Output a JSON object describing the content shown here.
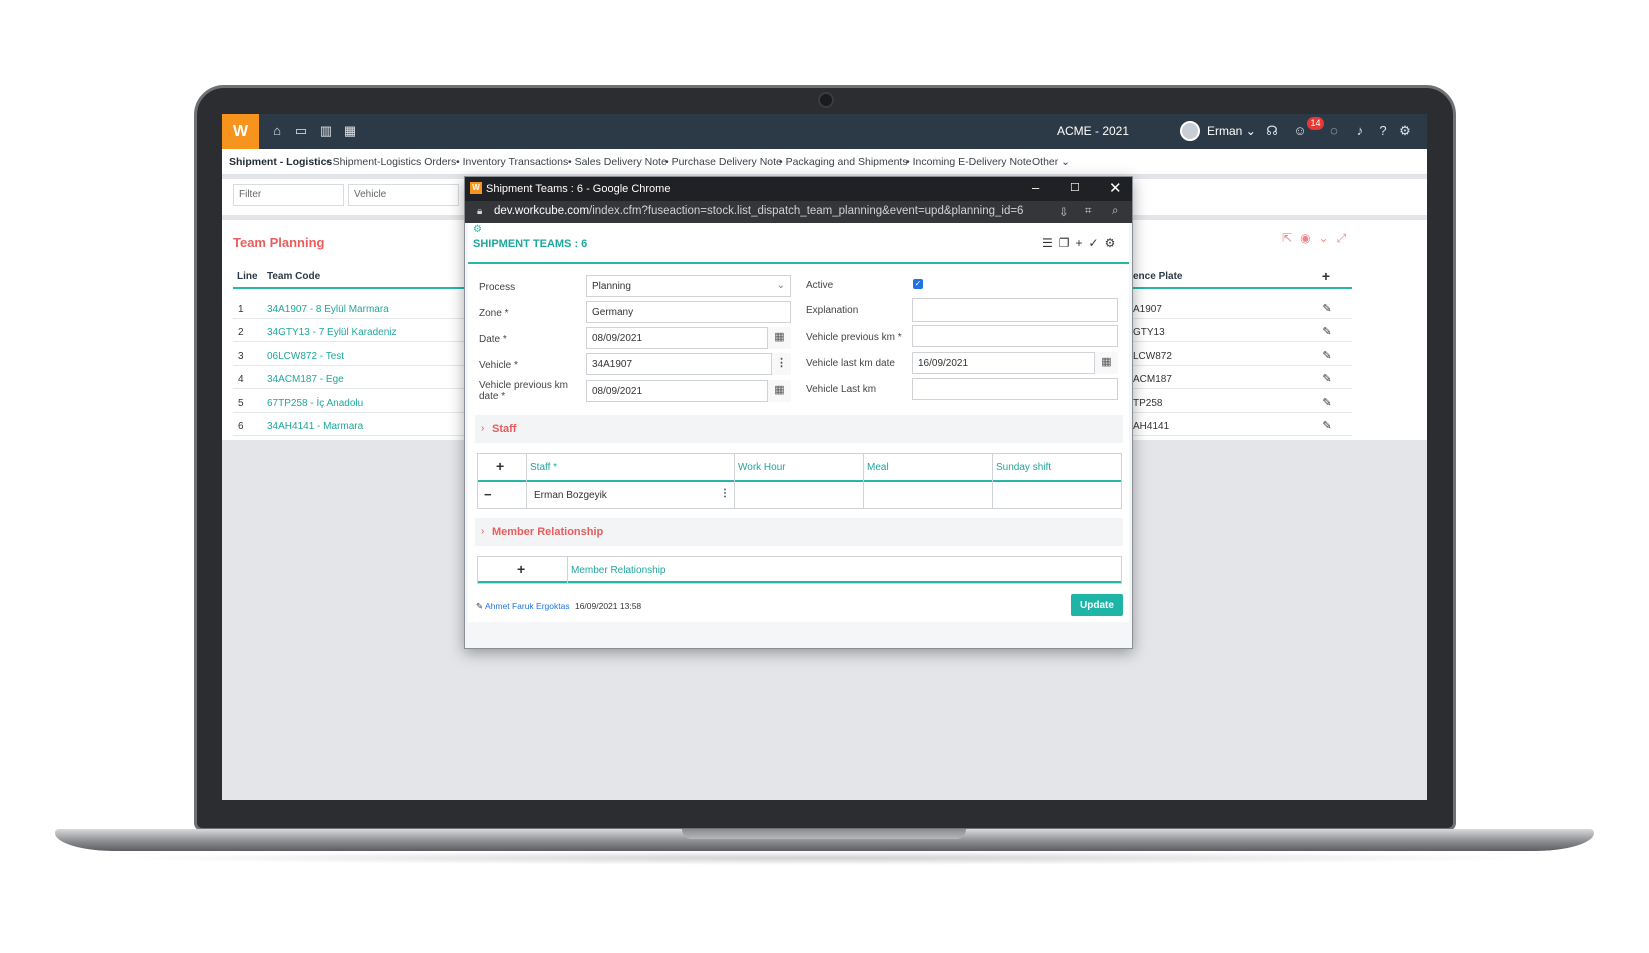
{
  "app": {
    "logo_text": "W",
    "company": "ACME - 2021",
    "user": "Erman",
    "notification_count": "14",
    "topbar_icons": [
      "home-icon",
      "box-icon",
      "chart-icon",
      "calendar-icon"
    ],
    "right_icons": [
      "headset-icon",
      "smile-icon",
      "chat-icon",
      "bell-icon",
      "help-icon",
      "gear-icon"
    ]
  },
  "subnav": {
    "items": [
      "Shipment - Logistics",
      "Shipment-Logistics Orders",
      "Inventory Transactions",
      "Sales Delivery Note",
      "Purchase Delivery Note",
      "Packaging and Shipments",
      "Incoming E-Delivery Note"
    ],
    "other": "Other"
  },
  "filters": {
    "filter_placeholder": "Filter",
    "vehicle_placeholder": "Vehicle"
  },
  "team_planning": {
    "title": "Team Planning",
    "columns": {
      "line": "Line",
      "team_code": "Team Code",
      "plate": "ence Plate"
    },
    "rows": [
      {
        "line": "1",
        "team": "34A1907 - 8 Eylül Marmara",
        "plate": "A1907"
      },
      {
        "line": "2",
        "team": "34GTY13 - 7 Eylül Karadeniz",
        "plate": "GTY13"
      },
      {
        "line": "3",
        "team": "06LCW872 - Test",
        "plate": "LCW872"
      },
      {
        "line": "4",
        "team": "34ACM187 - Ege",
        "plate": "ACM187"
      },
      {
        "line": "5",
        "team": "67TP258 - İç Anadolu",
        "plate": "TP258"
      },
      {
        "line": "6",
        "team": "34AH4141 - Marmara",
        "plate": "AH4141"
      }
    ]
  },
  "popup": {
    "window_title": "Shipment Teams : 6 - Google Chrome",
    "url_domain": "dev.workcube.com",
    "url_path": "/index.cfm?fuseaction=stock.list_dispatch_team_planning&event=upd&planning_id=6",
    "heading": "SHIPMENT TEAMS : 6",
    "labels": {
      "process": "Process",
      "zone": "Zone *",
      "date": "Date *",
      "vehicle": "Vehicle *",
      "vehicle_prev_km_date": "Vehicle previous km date *",
      "active": "Active",
      "explanation": "Explanation",
      "vehicle_prev_km": "Vehicle previous km *",
      "vehicle_last_km_date": "Vehicle last km date",
      "vehicle_last_km": "Vehicle Last km"
    },
    "values": {
      "process": "Planning",
      "zone": "Germany",
      "date": "08/09/2021",
      "vehicle": "34A1907",
      "vehicle_prev_km_date": "08/09/2021",
      "active": true,
      "explanation": "",
      "vehicle_prev_km": "",
      "vehicle_last_km_date": "16/09/2021",
      "vehicle_last_km": ""
    },
    "staff_section": "Staff",
    "staff_columns": [
      "Staff *",
      "Work Hour",
      "Meal",
      "Sunday shift"
    ],
    "staff_rows": [
      {
        "staff": "Erman Bozgeyik",
        "work_hour": "",
        "meal": "",
        "sunday_shift": ""
      }
    ],
    "member_section": "Member Relationship",
    "member_column": "Member Relationship",
    "footer_user": "Ahmet Faruk Ergoktas",
    "footer_time": "16/09/2021 13:58",
    "update_label": "Update"
  },
  "colors": {
    "accent": "#26b7a9",
    "link": "#1fa79a",
    "section_title": "#e85d5d",
    "topbar": "#2c3a47",
    "logo": "#f7941d"
  }
}
